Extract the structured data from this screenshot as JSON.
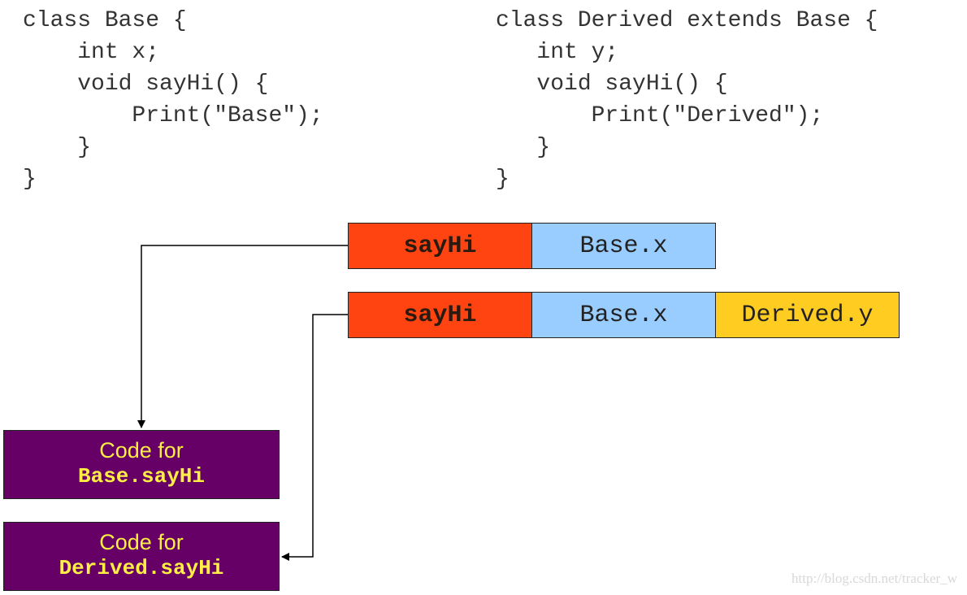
{
  "code": {
    "base": [
      "class Base {",
      "    int x;",
      "    void sayHi() {",
      "        Print(\"Base\");",
      "    }",
      "}"
    ],
    "derived": [
      "class Derived extends Base {",
      "   int y;",
      "   void sayHi() {",
      "       Print(\"Derived\");",
      "   }",
      "}"
    ]
  },
  "vtables": {
    "base": {
      "cells": [
        "sayHi",
        "Base.x"
      ]
    },
    "derived": {
      "cells": [
        "sayHi",
        "Base.x",
        "Derived.y"
      ]
    }
  },
  "code_boxes": {
    "base": {
      "caption": "Code for",
      "function": "Base.sayHi"
    },
    "derived": {
      "caption": "Code for",
      "function": "Derived.sayHi"
    }
  },
  "colors": {
    "method_cell": "#ff4412",
    "base_field_cell": "#99ccff",
    "derived_field_cell": "#ffcc22",
    "code_box_bg": "#660066",
    "code_box_text": "#ffee44"
  },
  "watermark": "http://blog.csdn.net/tracker_w"
}
